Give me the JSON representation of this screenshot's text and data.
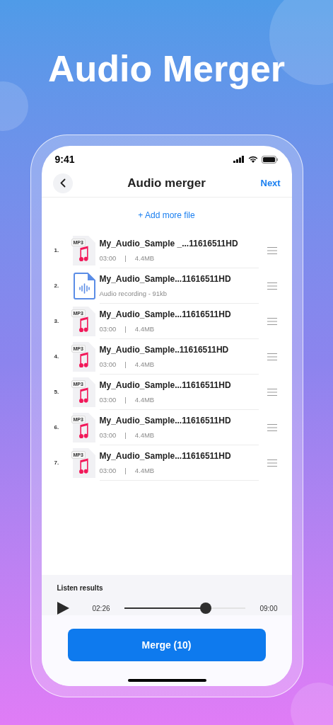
{
  "headline": "Audio Merger",
  "status_bar": {
    "time": "9:41"
  },
  "nav": {
    "title": "Audio merger",
    "action": "Next"
  },
  "add_link": "+ Add more file",
  "files": [
    {
      "index": "1.",
      "kind": "mp3",
      "badge": "MP3",
      "name": "My_Audio_Sample _...11616511HD",
      "duration": "03:00",
      "separator": "|",
      "size": "4.4MB"
    },
    {
      "index": "2.",
      "kind": "recording",
      "name": "My_Audio_Sample...11616511HD",
      "detail": "Audio recording - 91kb"
    },
    {
      "index": "3.",
      "kind": "mp3",
      "badge": "MP3",
      "name": "My_Audio_Sample...11616511HD",
      "duration": "03:00",
      "separator": "|",
      "size": "4.4MB"
    },
    {
      "index": "4.",
      "kind": "mp3",
      "badge": "MP3",
      "name": "My_Audio_Sample..11616511HD",
      "duration": "03:00",
      "separator": "|",
      "size": "4.4MB"
    },
    {
      "index": "5.",
      "kind": "mp3",
      "badge": "MP3",
      "name": "My_Audio_Sample...11616511HD",
      "duration": "03:00",
      "separator": "|",
      "size": "4.4MB"
    },
    {
      "index": "6.",
      "kind": "mp3",
      "badge": "MP3",
      "name": "My_Audio_Sample...11616511HD",
      "duration": "03:00",
      "separator": "|",
      "size": "4.4MB"
    },
    {
      "index": "7.",
      "kind": "mp3",
      "badge": "MP3",
      "name": "My_Audio_Sample...11616511HD",
      "duration": "03:00",
      "separator": "|",
      "size": "4.4MB"
    }
  ],
  "player": {
    "label": "Listen results",
    "elapsed": "02:26",
    "total": "09:00",
    "level": 0.67
  },
  "merge_button": "Merge (10)"
}
